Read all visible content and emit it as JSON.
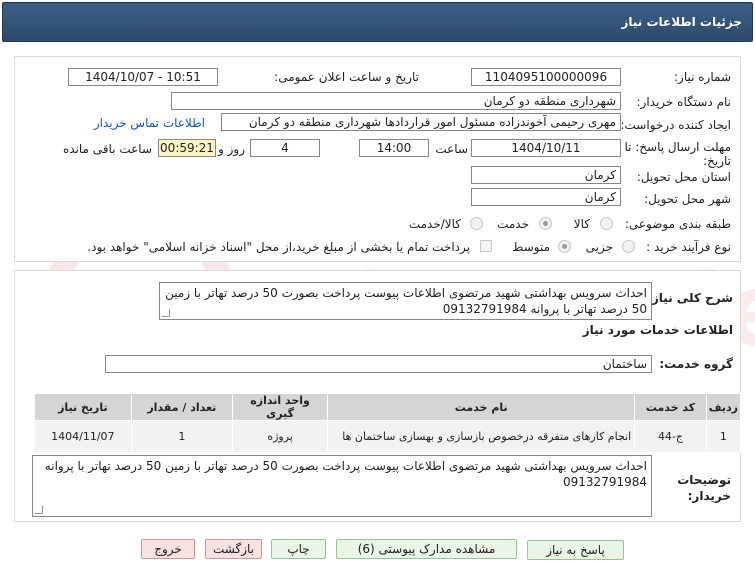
{
  "header": {
    "title": "جزئیات اطلاعات نیاز"
  },
  "form": {
    "need_number_label": "شماره نیاز:",
    "need_number": "1104095100000096",
    "announce_label": "تاریخ و ساعت اعلان عمومی:",
    "announce_value": "1404/10/07 - 10:51",
    "buyer_label": "نام دستگاه خریدار:",
    "buyer_value": "شهرداری منطقه دو کرمان",
    "creator_label": "ایجاد کننده درخواست:",
    "creator_value": "مهری رحیمی آخوندزاده مسئول امور قراردادها شهرداری منطقه دو کرمان",
    "contact_link": "اطلاعات تماس خریدار",
    "deadline_label": "مهلت ارسال پاسخ: تا تاریخ:",
    "deadline_date": "1404/10/11",
    "time_label": "ساعت",
    "deadline_time": "14:00",
    "days_value": "4",
    "days_label": "روز و",
    "remaining_time": "00:59:21",
    "remaining_label": "ساعت باقی مانده",
    "province_label": "استان محل تحویل:",
    "province_value": "کرمان",
    "city_label": "شهر محل تحویل:",
    "city_value": "کرمان",
    "category_label": "طبقه بندی موضوعی:",
    "category_options": [
      "کالا",
      "خدمت",
      "کالا/خدمت"
    ],
    "process_label": "نوع فرآیند خرید :",
    "process_options": [
      "جزیی",
      "متوسط"
    ],
    "payment_note": "پرداخت تمام یا بخشی از مبلغ خرید،از محل \"اسناد خزانه اسلامی\" خواهد بود."
  },
  "details": {
    "summary_label": "شرح کلی نیاز:",
    "summary_text": "احداث سرویس بهداشتی شهید مرتضوی اطلاعات پیوست پرداخت بصورت 50 درصد تهاتر با زمین 50 درصد تهاتر با پروانه 09132791984",
    "services_heading": "اطلاعات خدمات مورد نیاز",
    "service_group_label": "گروه خدمت:",
    "service_group_value": "ساختمان",
    "table": {
      "headers": [
        "ردیف",
        "کد خدمت",
        "نام خدمت",
        "واحد اندازه گیری",
        "تعداد / مقدار",
        "تاریخ نیاز"
      ],
      "rows": [
        [
          "1",
          "ج-44",
          "انجام کارهای متفرقه درخصوص بازسازی و بهسازی ساختمان ها",
          "پروژه",
          "1",
          "1404/11/07"
        ]
      ]
    },
    "buyer_notes_label": "توضیحات خریدار:",
    "buyer_notes_text": "احداث سرویس بهداشتی شهید مرتضوی اطلاعات پیوست پرداخت بصورت 50 درصد تهاتر با زمین 50 درصد تهاتر با پروانه 09132791984"
  },
  "buttons": {
    "reply": "پاسخ به نیاز",
    "attachments": "مشاهده مدارک پیوستی (6)",
    "print": "چاپ",
    "back": "بازگشت",
    "exit": "خروج"
  },
  "colors": {
    "header": "#2f4f72",
    "link": "#1a55b8",
    "button_green": "#eaf5e6",
    "button_red": "#f7e1e1"
  }
}
